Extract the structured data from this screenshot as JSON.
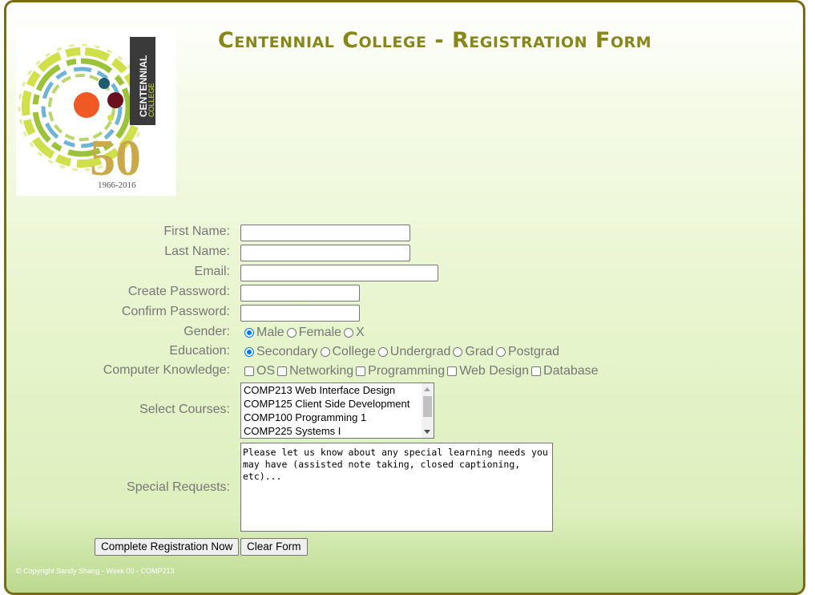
{
  "header": {
    "title": "Centennial College - Registration Form",
    "logo_text": "CENTENNIAL",
    "logo_subtext": "COLLEGE",
    "logo_number": "50",
    "logo_years": "1966-2016"
  },
  "form": {
    "first_name": {
      "label": "First Name:",
      "value": ""
    },
    "last_name": {
      "label": "Last Name:",
      "value": ""
    },
    "email": {
      "label": "Email:",
      "value": ""
    },
    "create_password": {
      "label": "Create Password:",
      "value": ""
    },
    "confirm_password": {
      "label": "Confirm Password:",
      "value": ""
    },
    "gender": {
      "label": "Gender:",
      "options": [
        {
          "label": "Male",
          "checked": true
        },
        {
          "label": "Female",
          "checked": false
        },
        {
          "label": "X",
          "checked": false
        }
      ]
    },
    "education": {
      "label": "Education:",
      "options": [
        {
          "label": "Secondary",
          "checked": true
        },
        {
          "label": "College",
          "checked": false
        },
        {
          "label": "Undergrad",
          "checked": false
        },
        {
          "label": "Grad",
          "checked": false
        },
        {
          "label": "Postgrad",
          "checked": false
        }
      ]
    },
    "computer_knowledge": {
      "label": "Computer Knowledge:",
      "options": [
        {
          "label": "OS",
          "checked": false
        },
        {
          "label": "Networking",
          "checked": false
        },
        {
          "label": "Programming",
          "checked": false
        },
        {
          "label": "Web Design",
          "checked": false
        },
        {
          "label": "Database",
          "checked": false
        }
      ]
    },
    "courses": {
      "label": "Select Courses:",
      "items": [
        "COMP213 Web Interface Design",
        "COMP125 Client Side Development",
        "COMP100 Programming 1",
        "COMP225 Systems I"
      ]
    },
    "special_requests": {
      "label": "Special Requests:",
      "placeholder": "Please let us know about any special learning needs you may have (assisted note taking, closed captioning, etc)..."
    }
  },
  "buttons": {
    "submit": "Complete Registration Now",
    "clear": "Clear Form"
  },
  "footer": {
    "text": "© Copyright Sandy Shang - Week 09 - COMP213"
  },
  "colors": {
    "title": "#87861b",
    "border": "#7a6a13",
    "label": "#777777",
    "accent": "#0075ff"
  }
}
